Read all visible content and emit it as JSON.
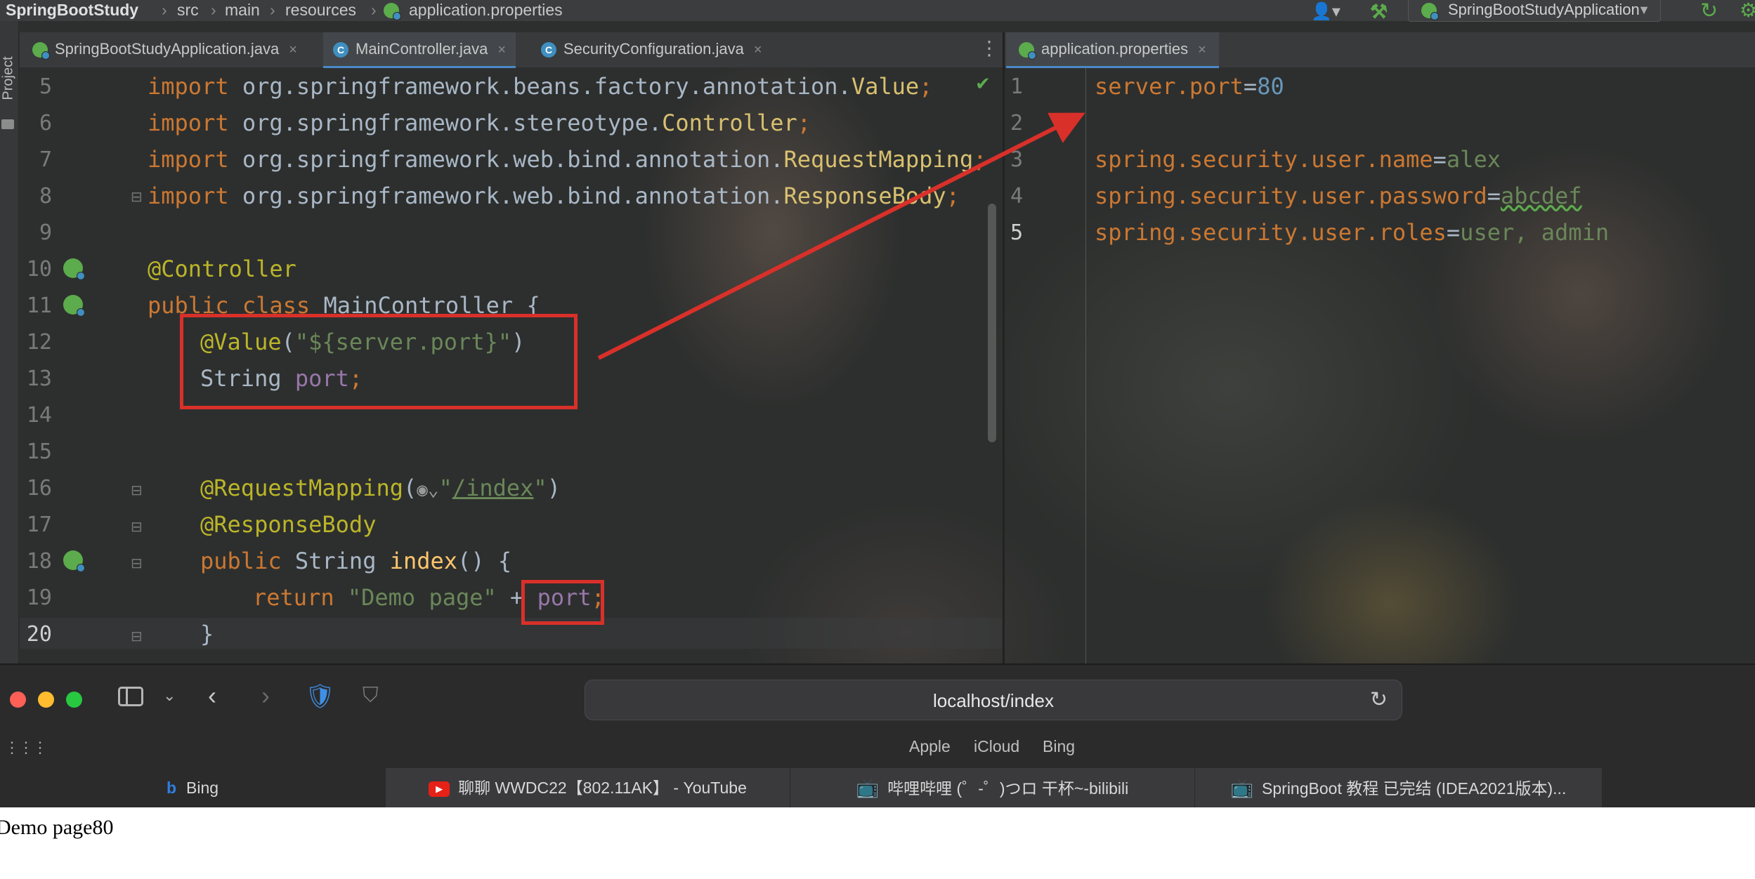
{
  "ide": {
    "breadcrumb": [
      "SpringBootStudy",
      "src",
      "main",
      "resources",
      "application.properties"
    ],
    "run_config": "SpringBootStudyApplication",
    "project_label": "Project",
    "left_tabs": [
      {
        "label": "SpringBootStudyApplication.java",
        "icon": "spring-app-icon"
      },
      {
        "label": "MainController.java",
        "icon": "java-class-icon",
        "active": true
      },
      {
        "label": "SecurityConfiguration.java",
        "icon": "java-class-icon"
      }
    ],
    "right_tab": {
      "label": "application.properties",
      "icon": "properties-icon"
    },
    "close_glyph": "×",
    "left_line_numbers": [
      "5",
      "6",
      "7",
      "8",
      "9",
      "10",
      "11",
      "12",
      "13",
      "14",
      "15",
      "16",
      "17",
      "18",
      "19",
      "20"
    ],
    "right_line_numbers": [
      "1",
      "2",
      "3",
      "4",
      "5"
    ],
    "java": {
      "l5": {
        "kw": "import",
        "pkg": " org.springframework.beans.factory.annotation.",
        "cls": "Value",
        "end": ";"
      },
      "l6": {
        "kw": "import",
        "pkg": " org.springframework.stereotype.",
        "cls": "Controller",
        "end": ";"
      },
      "l7": {
        "kw": "import",
        "pkg": " org.springframework.web.bind.annotation.",
        "cls": "RequestMapping",
        "end": ";"
      },
      "l8": {
        "kw": "import",
        "pkg": " org.springframework.web.bind.annotation.",
        "cls": "ResponseBody",
        "end": ";"
      },
      "l10": {
        "ann": "@Controller"
      },
      "l11": {
        "kw": "public class",
        "name": " MainController {"
      },
      "l12": {
        "ann": "@Value",
        "p1": "(",
        "str": "\"${server.port}\"",
        "p2": ")"
      },
      "l13": {
        "type": "String ",
        "fld": "port",
        "end": ";"
      },
      "l16": {
        "ann": "@RequestMapping",
        "p1": "(",
        "str_pre": "\"",
        "str_link": "/index",
        "str_post": "\"",
        "p2": ")"
      },
      "l17": {
        "ann": "@ResponseBody"
      },
      "l18": {
        "kw": "public",
        "type": " String ",
        "fn": "index",
        "rest": "() {"
      },
      "l19": {
        "kw": "return",
        "str": " \"Demo page\"",
        "plus": " + ",
        "fld": "port",
        "end": ";"
      },
      "l20": {
        "brace": "}"
      }
    },
    "properties": {
      "l1": {
        "key": "server.port",
        "eq": "=",
        "val": "80"
      },
      "l3": {
        "key": "spring.security.user.name",
        "eq": "=",
        "val": "alex"
      },
      "l4": {
        "key": "spring.security.user.password",
        "eq": "=",
        "val": "abcdef"
      },
      "l5": {
        "key": "spring.security.user.roles",
        "eq": "=",
        "val": "user, admin"
      }
    }
  },
  "browser": {
    "url": "localhost/index",
    "favorites": [
      "Apple",
      "iCloud",
      "Bing"
    ],
    "tabs": [
      "Bing",
      "聊聊 WWDC22【802.11AK】 - YouTube",
      "哔哩哔哩 (゜-゜)つロ 干杯~-bilibili",
      "SpringBoot 教程 已完结 (IDEA2021版本)..."
    ],
    "page_text": "Demo page80"
  },
  "colors": {
    "highlight_box": "#d9302a",
    "traffic_red": "#fe5f57",
    "traffic_yellow": "#febc2e",
    "traffic_green": "#28c840"
  }
}
